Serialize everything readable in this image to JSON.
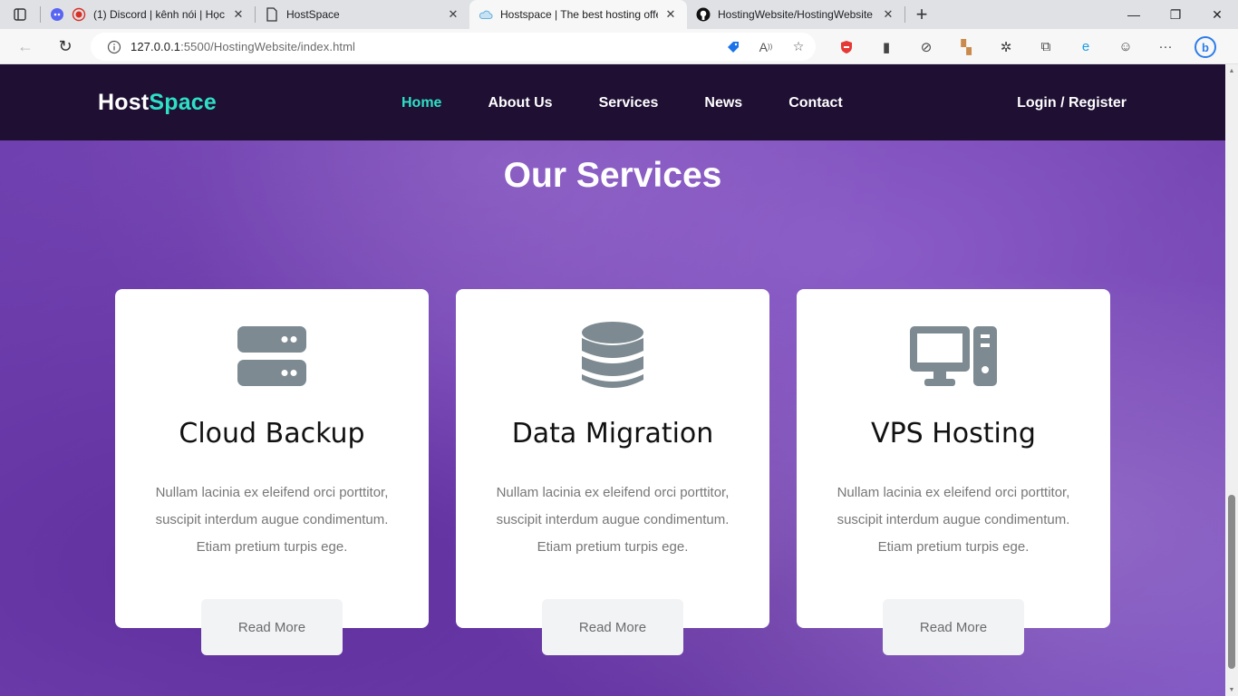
{
  "browser": {
    "tabs": [
      {
        "title": "(1) Discord | kênh nói | Học",
        "icon": "discord-icon"
      },
      {
        "title": "HostSpace",
        "icon": "page-icon"
      },
      {
        "title": "Hostspace | The best hosting offer",
        "icon": "cloud-icon",
        "active": true
      },
      {
        "title": "HostingWebsite/HostingWebsite",
        "icon": "github-icon"
      }
    ],
    "url_host": "127.0.0.1",
    "url_rest": ":5500/HostingWebsite/index.html"
  },
  "site": {
    "logo_part1": "Host",
    "logo_part2": "Space",
    "menu": [
      "Home",
      "About Us",
      "Services",
      "News",
      "Contact"
    ],
    "login": "Login / Register"
  },
  "services": {
    "title": "Our Services",
    "cards": [
      {
        "icon": "server-icon",
        "title": "Cloud Backup",
        "text": "Nullam lacinia ex eleifend orci porttitor, suscipit interdum augue condimentum. Etiam pretium turpis ege.",
        "button": "Read More"
      },
      {
        "icon": "database-icon",
        "title": "Data Migration",
        "text": "Nullam lacinia ex eleifend orci porttitor, suscipit interdum augue condimentum. Etiam pretium turpis ege.",
        "button": "Read More"
      },
      {
        "icon": "desktop-icon",
        "title": "VPS Hosting",
        "text": "Nullam lacinia ex eleifend orci porttitor, suscipit interdum augue condimentum. Etiam pretium turpis ege.",
        "button": "Read More"
      }
    ]
  },
  "colors": {
    "header_bg": "#1e0f33",
    "accent": "#2ee0c6",
    "icon_gray": "#7d8a91"
  }
}
